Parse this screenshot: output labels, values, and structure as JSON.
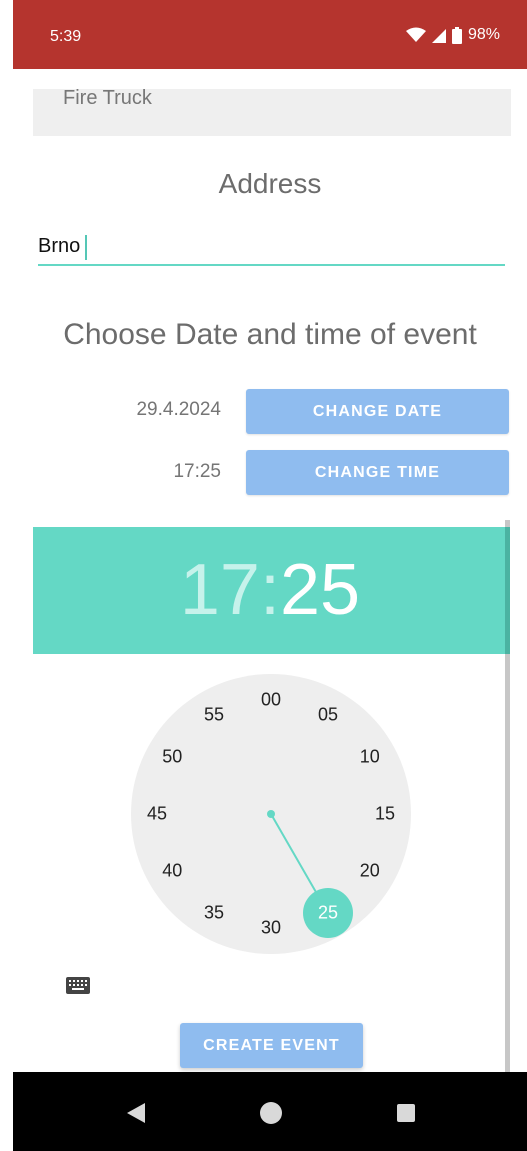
{
  "status_bar": {
    "time": "5:39",
    "battery": "98%"
  },
  "form": {
    "type_value": "Fire Truck",
    "address_label": "Address",
    "address_value": "Brno",
    "datetime_label": "Choose Date and time of event",
    "date_value": "29.4.2024",
    "change_date_label": "CHANGE DATE",
    "time_value": "17:25",
    "change_time_label": "CHANGE TIME",
    "create_event_label": "CREATE EVENT"
  },
  "time_picker": {
    "hour": "17",
    "separator": ":",
    "minute": "25",
    "selected_minute": "25",
    "minute_numbers": [
      "00",
      "05",
      "10",
      "15",
      "20",
      "25",
      "30",
      "35",
      "40",
      "45",
      "50",
      "55"
    ]
  },
  "colors": {
    "status_bar": "#b5342e",
    "accent": "#64d8c5",
    "button": "#8fbcef"
  },
  "icons": {
    "wifi": "wifi-icon",
    "signal": "signal-icon",
    "battery": "battery-icon",
    "keyboard": "keyboard-icon",
    "back": "back-icon",
    "home": "home-icon",
    "recents": "recents-icon"
  }
}
